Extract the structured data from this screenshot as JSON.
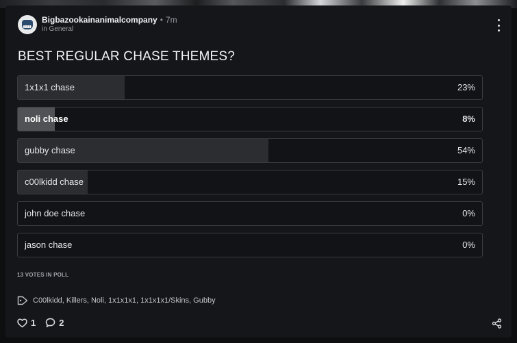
{
  "post": {
    "author": "Bigbazookainanimalcompany",
    "separator": "•",
    "time": "7m",
    "channel": "in General",
    "title": "BEST REGULAR CHASE THEMES?"
  },
  "poll": {
    "options": [
      {
        "label": "1x1x1 chase",
        "percent_text": "23%",
        "percent": 23,
        "selected": false
      },
      {
        "label": "noli chase",
        "percent_text": "8%",
        "percent": 8,
        "selected": true
      },
      {
        "label": "gubby chase",
        "percent_text": "54%",
        "percent": 54,
        "selected": false
      },
      {
        "label": "c00lkidd chase",
        "percent_text": "15%",
        "percent": 15,
        "selected": false
      },
      {
        "label": "john doe chase",
        "percent_text": "0%",
        "percent": 0,
        "selected": false
      },
      {
        "label": "jason chase",
        "percent_text": "0%",
        "percent": 0,
        "selected": false
      }
    ],
    "votes_text": "13 VOTES IN POLL"
  },
  "tags": {
    "icon": "tag-icon",
    "text": "C00lkidd, Killers, Noli, 1x1x1x1, 1x1x1x1/Skins, Gubby"
  },
  "actions": {
    "likes": "1",
    "comments": "2",
    "like_icon": "heart-icon",
    "comment_icon": "comment-icon",
    "share_icon": "share-icon",
    "more_icon": "more-vertical-icon"
  },
  "colors": {
    "card_bg": "#151619",
    "bar_fill": "#2c2d31",
    "bar_fill_selected": "#505256",
    "border": "#3a3c41"
  }
}
